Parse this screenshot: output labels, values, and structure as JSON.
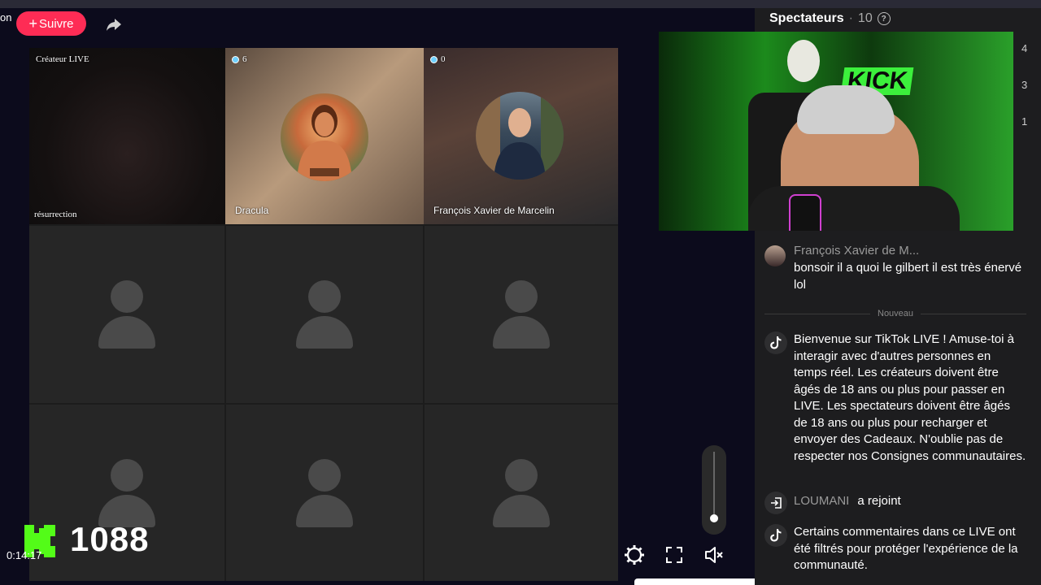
{
  "header": {
    "cut_text": "on",
    "follow_label": "Suivre",
    "follow_plus": "+"
  },
  "grid": {
    "tiles": [
      {
        "tag": "Créateur LIVE",
        "name": "résurrection"
      },
      {
        "tag": "6",
        "name": "Dracula"
      },
      {
        "tag": "0",
        "name": "François Xavier de Marcelin"
      }
    ]
  },
  "overlay": {
    "kick_count": "1088",
    "timer": "0:14:17"
  },
  "panel": {
    "title": "Spectateurs",
    "separator": "·",
    "viewer_count": "10",
    "help": "?",
    "side_numbers": [
      "4",
      "3",
      "1"
    ]
  },
  "stream": {
    "wall_sign": "KICK"
  },
  "chat": {
    "messages": [
      {
        "author": "François Xavier de M...",
        "text": "bonsoir il a quoi le gilbert il est très énervé lol"
      }
    ],
    "new_label": "Nouveau",
    "system_welcome": "Bienvenue sur TikTok LIVE ! Amuse-toi à interagir avec d'autres personnes en temps réel. Les créateurs doivent être âgés de 18 ans ou plus pour passer en LIVE. Les spectateurs doivent être âgés de 18 ans ou plus pour recharger et envoyer des Cadeaux. N'oublie pas de respecter nos Consignes communautaires.",
    "join": {
      "user": "LOUMANI",
      "action": "a rejoint"
    },
    "system_filter": "Certains commentaires dans ce LIVE ont été filtrés pour protéger l'expérience de la communauté."
  },
  "volume_level": 0.05,
  "colors": {
    "follow": "#fe2c55",
    "kick_green": "#53fc18",
    "panel_bg": "#1d1d1f",
    "stage_bg": "#0c0b1c"
  }
}
